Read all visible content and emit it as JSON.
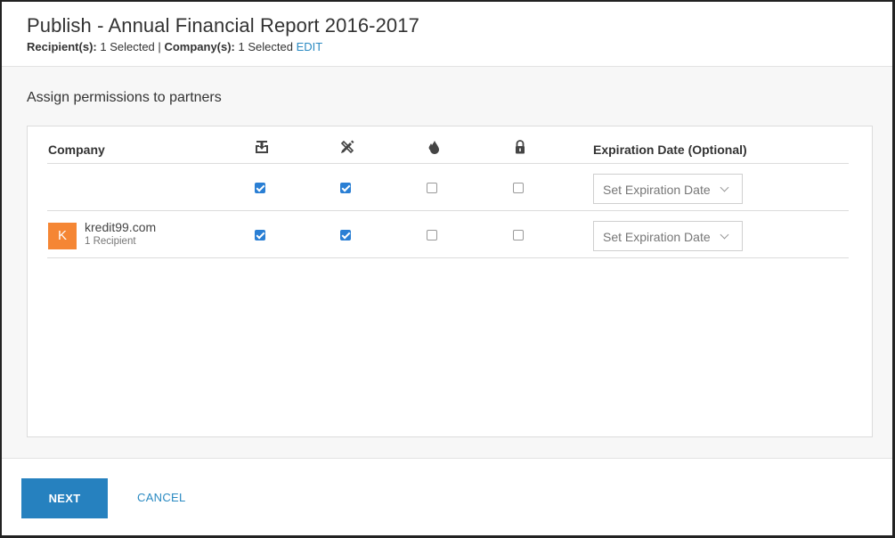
{
  "header": {
    "title": "Publish - Annual Financial Report 2016-2017",
    "recipients_label": "Recipient(s):",
    "recipients_value": "1 Selected",
    "separator": "|",
    "companies_label": "Company(s):",
    "companies_value": "1 Selected",
    "edit_label": "EDIT"
  },
  "main": {
    "section_label": "Assign permissions to partners",
    "table": {
      "columns": {
        "company": "Company",
        "download_icon": "download-icon",
        "edit_icon": "pencil-ruler-icon",
        "watermark_icon": "water-drop-icon",
        "lock_icon": "lock-icon",
        "expiration": "Expiration Date (Optional)"
      },
      "all_row": {
        "download": true,
        "edit": true,
        "watermark": false,
        "lock": false,
        "expiration_placeholder": "Set Expiration Date"
      },
      "rows": [
        {
          "avatar_letter": "K",
          "avatar_color": "#f58634",
          "company": "kredit99.com",
          "recipients": "1 Recipient",
          "download": true,
          "edit": true,
          "watermark": false,
          "lock": false,
          "expiration_placeholder": "Set Expiration Date"
        }
      ]
    }
  },
  "footer": {
    "next_label": "NEXT",
    "cancel_label": "CANCEL"
  },
  "colors": {
    "accent": "#2681bf",
    "link": "#2a8ac2",
    "checkbox_checked": "#2a7fd4"
  }
}
